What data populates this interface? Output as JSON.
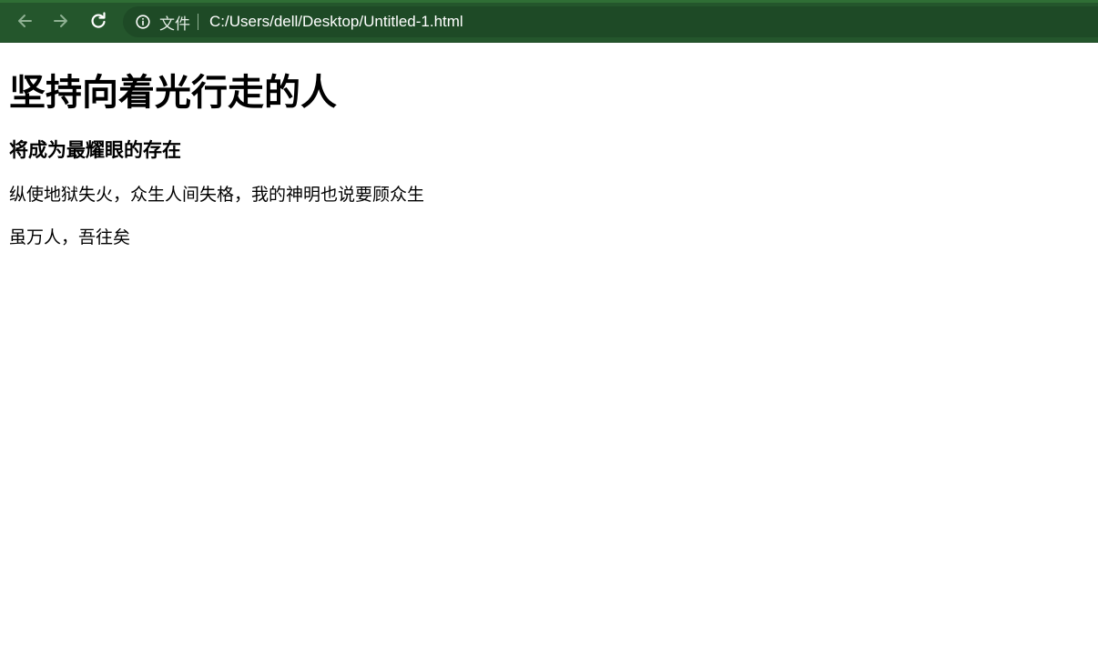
{
  "browser": {
    "back_icon": "arrow-left-icon",
    "forward_icon": "arrow-right-icon",
    "reload_icon": "reload-icon",
    "info_icon": "info-icon",
    "scheme_label": "文件",
    "url": "C:/Users/dell/Desktop/Untitled-1.html",
    "colors": {
      "toolbar": "#24562c",
      "omnibox": "#1e4a26",
      "icon": "#ffffff",
      "icon_disabled": "#8fb193"
    }
  },
  "page": {
    "heading": "坚持向着光行走的人",
    "subheading": "将成为最耀眼的存在",
    "paragraphs": [
      "纵使地狱失火，众生人间失格，我的神明也说要顾众生",
      "虽万人，吾往矣"
    ]
  }
}
